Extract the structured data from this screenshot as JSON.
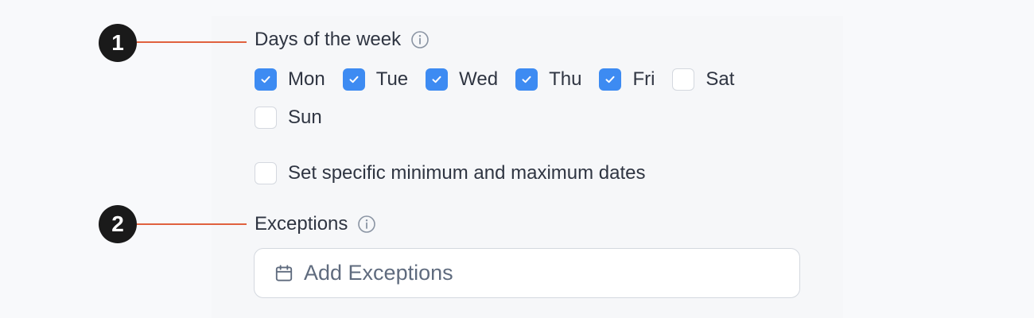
{
  "annotations": {
    "marker_1": "1",
    "marker_2": "2",
    "leader_color": "#e0613e"
  },
  "days_section": {
    "label": "Days of the week",
    "info_icon": "info-icon",
    "days": [
      {
        "label": "Mon",
        "checked": true
      },
      {
        "label": "Tue",
        "checked": true
      },
      {
        "label": "Wed",
        "checked": true
      },
      {
        "label": "Thu",
        "checked": true
      },
      {
        "label": "Fri",
        "checked": true
      },
      {
        "label": "Sat",
        "checked": false
      },
      {
        "label": "Sun",
        "checked": false
      }
    ]
  },
  "min_max": {
    "label": "Set specific minimum and maximum dates",
    "checked": false
  },
  "exceptions_section": {
    "label": "Exceptions",
    "info_icon": "info-icon",
    "placeholder": "Add Exceptions",
    "icon": "calendar-icon"
  },
  "colors": {
    "checkbox_on": "#3d8bf2",
    "panel_bg": "#f6f7f9"
  }
}
